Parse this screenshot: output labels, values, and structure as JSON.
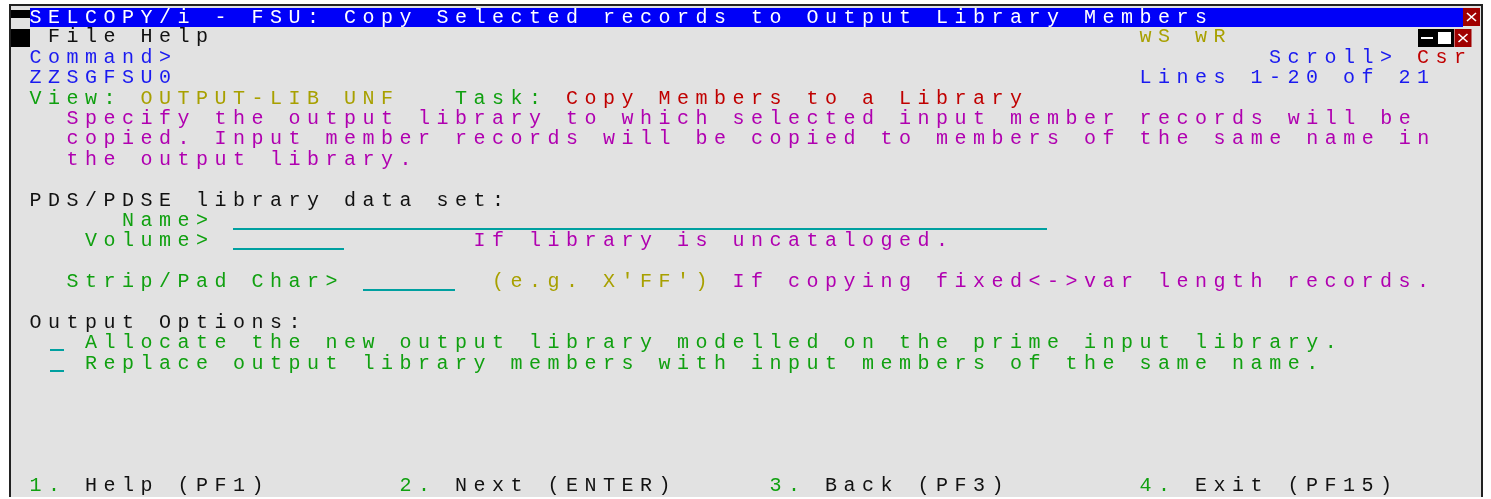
{
  "title_bar": {
    "title": "SELCOPY/i - FSU: Copy Selected records to Output Library Members"
  },
  "menu_bar": {
    "items": [
      "File",
      "Help"
    ]
  },
  "window_flags": "wS wR",
  "command": {
    "label": "Command>"
  },
  "scroll": {
    "label": "Scroll>",
    "value": "Csr"
  },
  "panel_id": "ZZSGFSU0",
  "lines_info": "Lines 1-20 of 21",
  "view": {
    "label": "View:",
    "value": "OUTPUT-LIB UNF"
  },
  "task": {
    "label": "Task:",
    "value": "Copy Members to a Library"
  },
  "description": "Specify the output library to which selected input member records will be copied. Input member records will be copied to members of the same name in the output library.",
  "library": {
    "heading": "PDS/PDSE library data set:",
    "name_field": {
      "label": "Name>"
    },
    "volume_field": {
      "label": "Volume>",
      "note": "If library is uncataloged."
    },
    "strip_pad_field": {
      "label": "Strip/Pad Char>",
      "example": "(e.g. X'FF')",
      "note": "If copying fixed<->var length records."
    }
  },
  "output_options": {
    "heading": "Output Options:",
    "options": [
      {
        "text": "Allocate the new output library modelled on the prime input library.",
        "checked": false
      },
      {
        "text": "Replace output library members with input members of the same name.",
        "checked": false
      }
    ]
  },
  "function_keys": [
    {
      "number": "1.",
      "label": "Help (PF1)"
    },
    {
      "number": "2.",
      "label": "Next (ENTER)"
    },
    {
      "number": "3.",
      "label": "Back (PF3)"
    },
    {
      "number": "4.",
      "label": "Exit (PF15)"
    }
  ]
}
